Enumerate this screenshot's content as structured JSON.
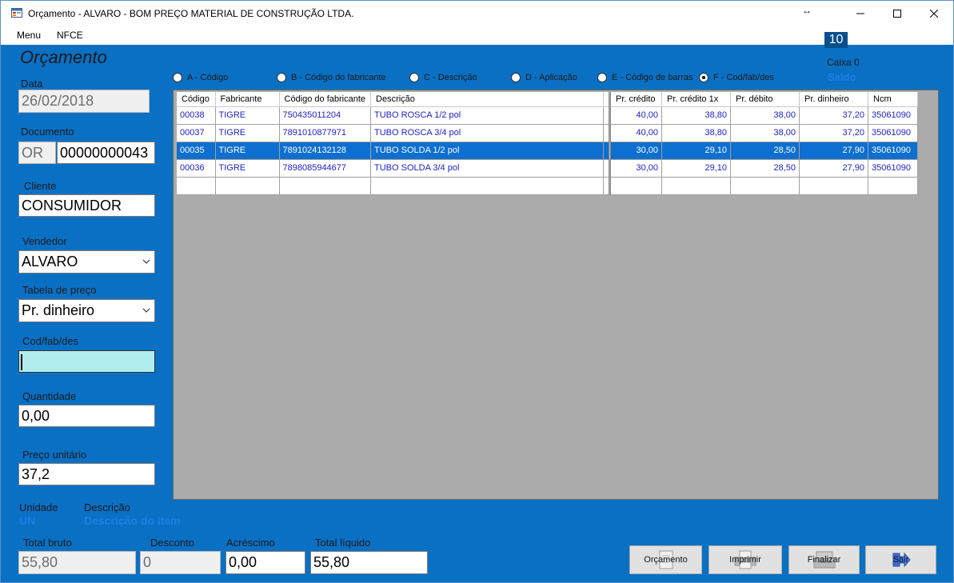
{
  "window": {
    "title": "Orçamento - ALVARO - BOM PREÇO MATERIAL DE CONSTRUÇÃO LTDA.",
    "icons": {
      "app": "app-form-icon",
      "resize": "resize-horizontal-icon",
      "minimize": "minimize-icon",
      "maximize": "maximize-icon",
      "close": "close-icon"
    }
  },
  "menu": {
    "items": [
      "Menu",
      "NFCE"
    ]
  },
  "header": {
    "title": "Orçamento",
    "counter": "10",
    "caixa": "Caixa 0",
    "saldo": "Saldo"
  },
  "form": {
    "data_label": "Data",
    "data_value": "26/02/2018",
    "documento_label": "Documento",
    "documento_prefix": "OR",
    "documento_value": "00000000043",
    "cliente_label": "Cliente",
    "cliente_value": "CONSUMIDOR",
    "vendedor_label": "Vendedor",
    "vendedor_value": "ALVARO",
    "tabela_label": "Tabela de preço",
    "tabela_value": "Pr. dinheiro",
    "busca_label": "Cod/fab/des",
    "busca_value": "",
    "quantidade_label": "Quantidade",
    "quantidade_value": "0,00",
    "preco_label": "Preço unitário",
    "preco_value": "37,2",
    "unidade_label": "Unidade",
    "unidade_value": "UN",
    "descricao_label": "Descrição",
    "descricao_value": "Descrição do item"
  },
  "search_modes": [
    {
      "label": "A - Código",
      "checked": false
    },
    {
      "label": "B - Código do fabricante",
      "checked": false
    },
    {
      "label": "C - Descrição",
      "checked": false
    },
    {
      "label": "D - Aplicação",
      "checked": false
    },
    {
      "label": "E - Código de barras",
      "checked": false
    },
    {
      "label": "F - Cod/fab/des",
      "checked": true
    }
  ],
  "grid": {
    "columns": [
      "Código",
      "Fabricante",
      "Código do fabricante",
      "Descrição",
      "Pr. crédito",
      "Pr. crédito 1x",
      "Pr. débito",
      "Pr. dinheiro",
      "Ncm"
    ],
    "rows": [
      {
        "codigo": "00038",
        "fabricante": "TIGRE",
        "cod_fab": "750435011204",
        "descricao": "TUBO ROSCA 1/2 pol",
        "credito": "40,00",
        "credito1x": "38,80",
        "debito": "38,00",
        "dinheiro": "37,20",
        "ncm": "35061090"
      },
      {
        "codigo": "00037",
        "fabricante": "TIGRE",
        "cod_fab": "7891010877971",
        "descricao": "TUBO ROSCA 3/4 pol",
        "credito": "40,00",
        "credito1x": "38,80",
        "debito": "38,00",
        "dinheiro": "37,20",
        "ncm": "35061090"
      },
      {
        "codigo": "00035",
        "fabricante": "TIGRE",
        "cod_fab": "7891024132128",
        "descricao": "TUBO SOLDA 1/2 pol",
        "credito": "30,00",
        "credito1x": "29,10",
        "debito": "28,50",
        "dinheiro": "27,90",
        "ncm": "35061090"
      },
      {
        "codigo": "00036",
        "fabricante": "TIGRE",
        "cod_fab": "7898085944677",
        "descricao": "TUBO SOLDA 3/4 pol",
        "credito": "30,00",
        "credito1x": "29,10",
        "debito": "28,50",
        "dinheiro": "27,90",
        "ncm": "35061090"
      }
    ],
    "selected_row": 2
  },
  "totals": {
    "bruto_label": "Total bruto",
    "bruto_value": "55,80",
    "desconto_label": "Desconto",
    "desconto_value": "0",
    "acrescimo_label": "Acréscimo",
    "acrescimo_value": "0,00",
    "liquido_label": "Total líquido",
    "liquido_value": "55,80"
  },
  "buttons": {
    "orcamento": "Orçamento",
    "imprimir": "Imprimir",
    "finalizar": "Finalizar",
    "sair": "Sair"
  },
  "colors": {
    "background": "#0a70c4",
    "selection": "#0d6fd0",
    "grid_text": "#1f22c8",
    "search_field": "#b1edee"
  }
}
